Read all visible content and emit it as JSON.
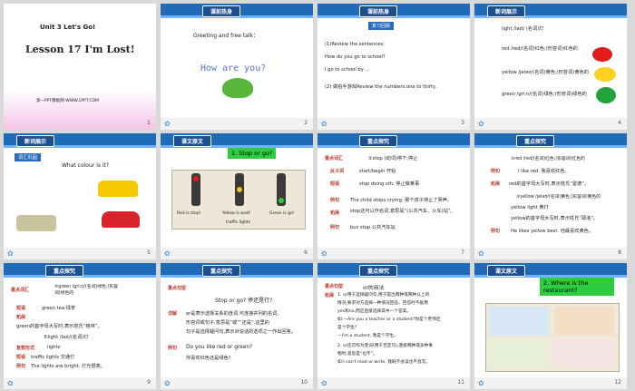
{
  "slides": [
    {
      "num": "1",
      "unit": "Unit 3   Let's Go!",
      "lesson": "Lesson 17   I'm Lost!",
      "footer": "第一PPT模板网-WWW.1PPT.COM"
    },
    {
      "num": "2",
      "badge": "课前热身",
      "line1": "Greeting and free talk：",
      "line2": "How are you?"
    },
    {
      "num": "3",
      "badge": "课前热身",
      "sub": "复习回顾",
      "l1": "(1)Review  the sentences:",
      "l2": "How do you go to school?",
      "l3": "I go to school by …",
      "l4": "(2)  做拍手游戏Review  the numbers:one to thirty."
    },
    {
      "num": "4",
      "badge": "新词展示",
      "w1": "light /laɪt/ (名词)灯",
      "w2": "red /red/(名词)红色;(形容词)红色的",
      "w3": "yellow /jeləʊ/(名词)黄色;(形容词)黄色的",
      "w4": "green /ɡriːn/(名词)绿色;(形容词)绿色的"
    },
    {
      "num": "5",
      "badge": "新词展示",
      "sub": "词汇巩固",
      "q": "What colour is it?"
    },
    {
      "num": "6",
      "badge": "课文原文",
      "title": "1. Stop or go?",
      "c1": "Red is stop!",
      "c2": "Yellow is wait!",
      "c3": "Green is go!",
      "c4": "traffic lights"
    },
    {
      "num": "7",
      "badge": "重点探究",
      "tag": "重点词汇",
      "w": "①stop (动词)停下;停止",
      "a1": "反义词",
      "a1v": "start/begin 开始",
      "a2": "短语",
      "a2v": "stop doing sth. 停止做某事",
      "a3": "例句",
      "a3v": "The child stops crying. 那个孩子停止了哭声。",
      "a4": "拓展",
      "a4v": "stop还可以作名词,意思是“(公共汽车、火车)站”。",
      "a5": "例句",
      "a5v": "bus stop 公共汽车站"
    },
    {
      "num": "8",
      "badge": "重点探究",
      "w": "②red /red/(名词)红色;(形容词)红色的",
      "e1": "I like red. 我喜欢红色。",
      "e2": "red的首字母大写时,表示姓氏“雷德”。",
      "w2": "③yellow /jeləʊ/(名词)黄色;(形容词)黄色的",
      "e3": "yellow light 黄灯",
      "e4": "yellow的首字母大写时,表示姓氏“耶洛”。",
      "e5": "He likes yellow best. 他最喜欢黄色。",
      "k1": "例句",
      "k2": "拓展"
    },
    {
      "num": "9",
      "badge": "重点探究",
      "tag": "重点词汇",
      "w": "④green /ɡriːn/(名词)绿色;(形容词)绿色的",
      "p1": "短语",
      "p1v": "green tea 绿茶",
      "p2": "拓展",
      "p2v": "green的首字母大写时,表示姓氏“格林”。",
      "w2": "⑤light /laɪt/(名词)灯",
      "p3": "复数形式",
      "p3v": "lights",
      "p4": "短语",
      "p4v": "traffic lights 交通灯",
      "p5": "例句",
      "p5v": "The lights are bright. 灯光很亮。"
    },
    {
      "num": "10",
      "badge": "重点探究",
      "tag": "重点句型",
      "s": "Stop or go? 停还是行?",
      "d1": "详解",
      "d1v": "or是表示选择关系的连词,可连接并列的名词、",
      "d2": "形容词或句子,意思是“或”“还是”,这里的",
      "d3": "句子是选择疑问句,表示对说话的选项之一作出回答。",
      "d4": "例句",
      "d4v": "Do you like red or green?",
      "d5": "你喜欢红色还是绿色?"
    },
    {
      "num": "11",
      "badge": "重点探究",
      "tag": "重点句型",
      "h": "or的用法",
      "b1": "1. or用于选择疑问句,用于提出两种或两种以上的",
      "b2": "情况,要求对方选择一种情况回答。回答时不能用",
      "b3": "yes和no,而应直接选择其中一个答案。",
      "b4": "如:—Are you a teacher or a student?你是个老师还",
      "b5": "是个学生?",
      "b6": "—I'm a student. 我是个学生。",
      "b7": "2. or还可作为连词(用于否定句),连接两种或多种事",
      "b8": "物时,意思是“也不”。",
      "b9": "如:I can't read or write. 我既不会读也不会写。",
      "k": "拓展"
    },
    {
      "num": "12",
      "badge": "课文原文",
      "title": "2. Where is the restaurant?"
    }
  ],
  "colors": {
    "header": "#1f6bb8",
    "badge": "#1b4f93",
    "accent": "#2ecc40"
  }
}
